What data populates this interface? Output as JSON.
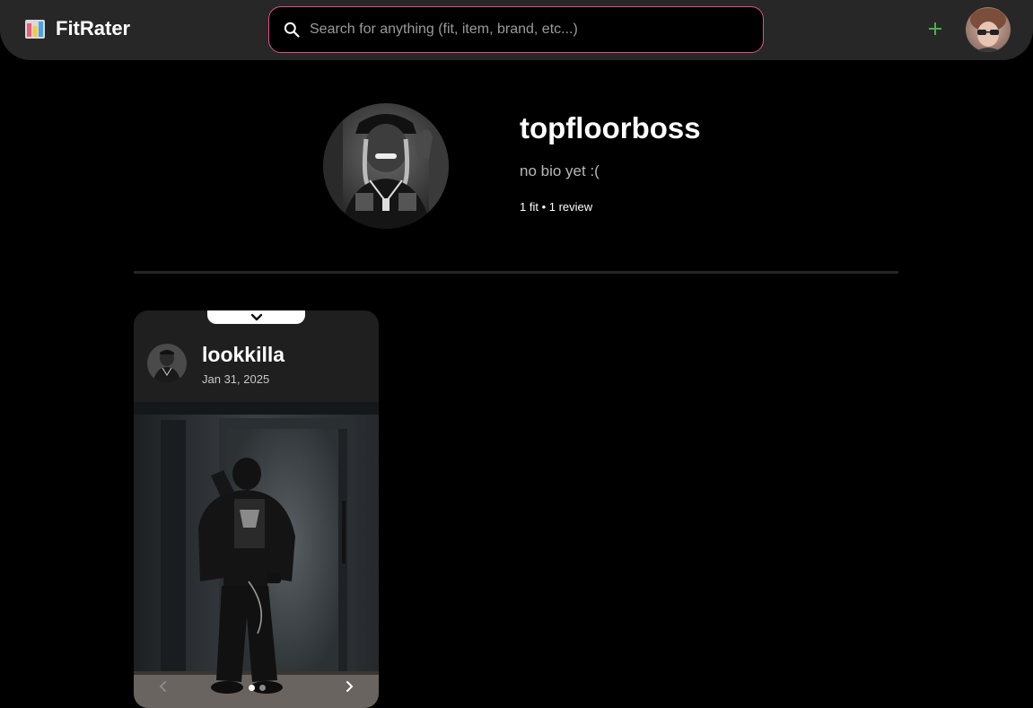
{
  "header": {
    "app_name": "FitRater",
    "logo_icon": "bar-chart-icon",
    "search_placeholder": "Search for anything (fit, item, brand, etc...)",
    "search_value": "",
    "add_icon": "plus-icon",
    "accent_color": "#e0518e",
    "add_color": "#4caf50"
  },
  "profile": {
    "username": "topfloorboss",
    "bio": "no bio yet :(",
    "stats": "1 fit • 1 review"
  },
  "fits": [
    {
      "username": "lookkilla",
      "date": "Jan 31, 2025",
      "photo_count": 2,
      "active_photo": 1
    }
  ]
}
